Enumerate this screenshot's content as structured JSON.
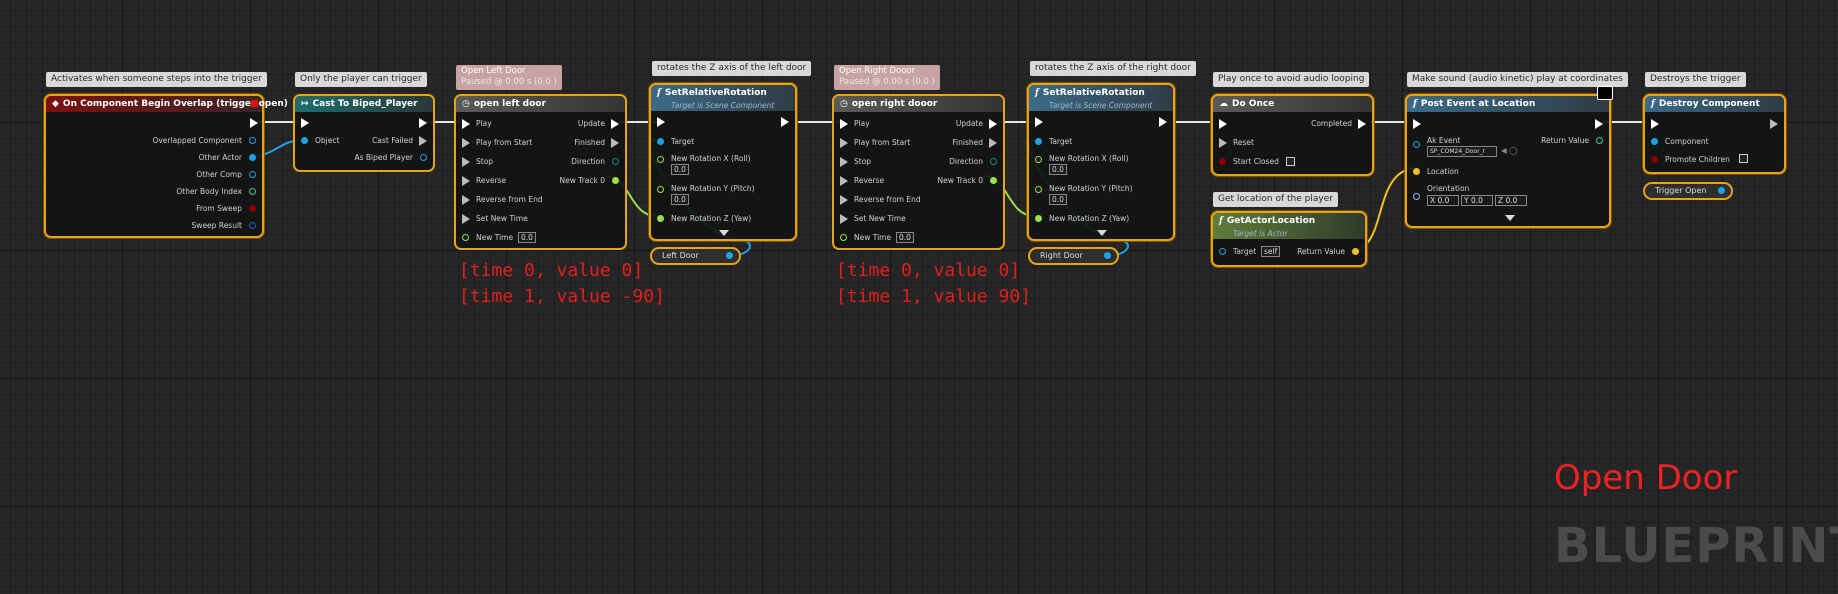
{
  "comments": {
    "overlap": "Activates when someone steps into the trigger",
    "cast": "Only the player can trigger",
    "left_tl_title": "Open Left Door",
    "left_tl_sub": "Paused @ 0.00 s (0.0 )",
    "left_rot": "rotates the Z axis of the left door",
    "right_tl_title": "Open Right Dooor",
    "right_tl_sub": "Paused @ 0.00 s (0.0 )",
    "right_rot": "rotates the Z axis of the right door",
    "do_once": "Play once to avoid audio looping",
    "post_event": "Make sound (audio kinetic) play at coordinates",
    "get_loc": "Get location of the player",
    "destroy": "Destroys the trigger"
  },
  "overlap": {
    "title": "On Component Begin Overlap (trigger open)",
    "pins": [
      "Overlapped Component",
      "Other Actor",
      "Other Comp",
      "Other Body Index",
      "From Sweep",
      "Sweep Result"
    ]
  },
  "cast": {
    "title": "Cast To Biped_Player",
    "object": "Object",
    "failed": "Cast Failed",
    "as": "As Biped Player"
  },
  "tl_left": {
    "title": "open left door",
    "inputs": [
      "Play",
      "Play from Start",
      "Stop",
      "Reverse",
      "Reverse from End",
      "Set New Time",
      "New Time"
    ],
    "outputs": [
      "Update",
      "Finished",
      "Direction",
      "New Track 0"
    ],
    "new_time": "0.0"
  },
  "rot_left": {
    "title": "SetRelativeRotation",
    "subtitle": "Target is Scene Component",
    "target": "Target",
    "x": "New Rotation X (Roll)",
    "x_val": "0.0",
    "y": "New Rotation Y (Pitch)",
    "y_val": "0.0",
    "z": "New Rotation Z (Yaw)"
  },
  "var_left": "Left Door",
  "tl_right": {
    "title": "open right dooor",
    "inputs": [
      "Play",
      "Play from Start",
      "Stop",
      "Reverse",
      "Reverse from End",
      "Set New Time",
      "New Time"
    ],
    "outputs": [
      "Update",
      "Finished",
      "Direction",
      "New Track 0"
    ],
    "new_time": "0.0"
  },
  "rot_right": {
    "title": "SetRelativeRotation",
    "subtitle": "Target is Scene Component",
    "target": "Target",
    "x": "New Rotation X (Roll)",
    "x_val": "0.0",
    "y": "New Rotation Y (Pitch)",
    "y_val": "0.0",
    "z": "New Rotation Z (Yaw)"
  },
  "var_right": "Right Door",
  "do_once": {
    "title": "Do Once",
    "completed": "Completed",
    "reset": "Reset",
    "start_closed": "Start Closed"
  },
  "get_loc": {
    "title": "GetActorLocation",
    "subtitle": "Target is Actor",
    "target": "Target",
    "self": "self",
    "ret": "Return Value"
  },
  "post_event": {
    "title": "Post Event at Location",
    "ak_event": "Ak Event",
    "ak_val": "SP_COM24_Door_r",
    "ret": "Return Value",
    "location": "Location",
    "orientation": "Orientation",
    "ox_l": "X",
    "ox": "0.0",
    "oy_l": "Y",
    "oy": "0.0",
    "oz_l": "Z",
    "oz": "0.0"
  },
  "destroy": {
    "title": "Destroy Component",
    "component": "Component",
    "promote": "Promote Children"
  },
  "var_trigger": "Trigger Open",
  "notes": {
    "left1": "[time 0, value 0]",
    "left2": "[time 1, value -90]",
    "right1": "[time 0, value 0]",
    "right2": "[time 1, value 90]"
  },
  "graph_title": "Open Door",
  "watermark": "BLUEPRINT",
  "colors": {
    "selection": "#e8a419",
    "exec": "#ffffff",
    "object_pin": "#1fa2e0",
    "float_pin": "#9ae04a",
    "vector_pin": "#f2c21a",
    "bool_pin": "#8b0000",
    "note_red": "#e31e1e"
  }
}
